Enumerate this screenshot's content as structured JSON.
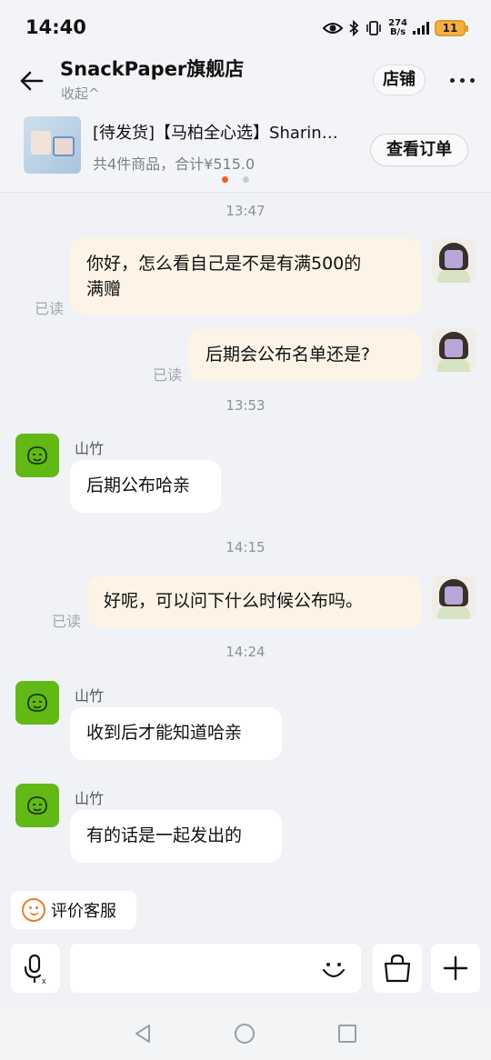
{
  "status_bar": {
    "time": "14:40",
    "net_speed_value": "274",
    "net_speed_unit": "B/s",
    "battery": "11"
  },
  "header": {
    "title": "SnackPaper旗舰店",
    "collapse_label": "收起^",
    "shop_button": "店铺",
    "more_icon": "more-dots-icon"
  },
  "order_card": {
    "title": "[待发货]【马柏全心选】Sharin…",
    "summary": "共4件商品，合计¥515.0",
    "view_order_button": "查看订单",
    "pager_dots": 2,
    "active_dot": 0
  },
  "messages": {
    "ts_1": "13:47",
    "m1_line1": "你好，怎么看自己是不是有满500的",
    "m1_line2": "满赠",
    "m1_read": "已读",
    "m2": "后期会公布名单还是?",
    "m2_read": "已读",
    "ts_2": "13:53",
    "agent_1_name": "山竹",
    "a1": "后期公布哈亲",
    "ts_3": "14:15",
    "m3": "好呢，可以问下什么时候公布吗。",
    "m3_read": "已读",
    "ts_4": "14:24",
    "agent_2_name": "山竹",
    "a2": "收到后才能知道哈亲",
    "agent_3_name": "山竹",
    "a3": "有的话是一起发出的"
  },
  "rate_service": {
    "label": "评价客服",
    "icon": "smile-icon"
  },
  "input_bar": {
    "text_value": "",
    "voice_icon": "microphone-icon",
    "emoji_icon": "emoji-icon",
    "bag_icon": "shopping-bag-icon",
    "plus_icon": "plus-icon"
  },
  "colors": {
    "accent": "#f45b1f",
    "outgoing_bubble": "#fdf3e6",
    "agent_avatar": "#62b815",
    "background": "#f0f2f5"
  }
}
